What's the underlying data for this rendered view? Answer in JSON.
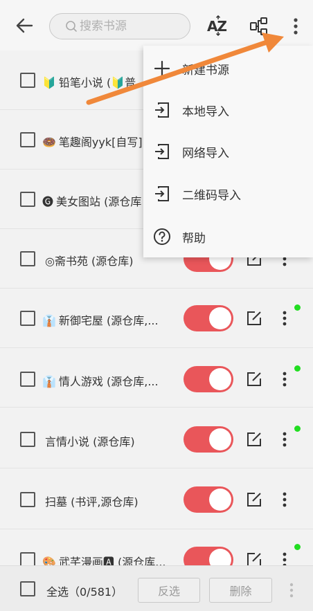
{
  "header": {
    "search_placeholder": "搜索书源",
    "sort_label": "AZ"
  },
  "menu": {
    "items": [
      {
        "label": "新建书源",
        "icon": "plus-icon"
      },
      {
        "label": "本地导入",
        "icon": "import-icon"
      },
      {
        "label": "网络导入",
        "icon": "import-icon"
      },
      {
        "label": "二维码导入",
        "icon": "import-icon"
      },
      {
        "label": "帮助",
        "icon": "help-icon"
      }
    ]
  },
  "sources": [
    {
      "emoji": "🔰",
      "name": "铅笔小说 (🔰普"
    },
    {
      "emoji": "🍩",
      "name": "笔趣阁yyk[自写]"
    },
    {
      "emoji": "🅖",
      "name": "美女图站 (源仓库"
    },
    {
      "emoji": "",
      "name": "◎斋书苑 (源仓库)"
    },
    {
      "emoji": "👔",
      "name": "新御宅屋 (源仓库,..."
    },
    {
      "emoji": "👔",
      "name": "情人游戏 (源仓库,..."
    },
    {
      "emoji": "",
      "name": "言情小说 (源仓库)"
    },
    {
      "emoji": "",
      "name": "扫墓 (书评,源仓库)"
    },
    {
      "emoji": "🎨",
      "name": "武芊漫画🅰 (源仓库..."
    }
  ],
  "status_dots": [
    false,
    false,
    false,
    false,
    true,
    true,
    true,
    false,
    true
  ],
  "bottom": {
    "select_all": "全选（0/581）",
    "invert": "反选",
    "delete": "删除"
  },
  "colors": {
    "toggle_on": "#e9565a",
    "status_dot": "#22dd22",
    "annotation_arrow": "#f0883a"
  }
}
